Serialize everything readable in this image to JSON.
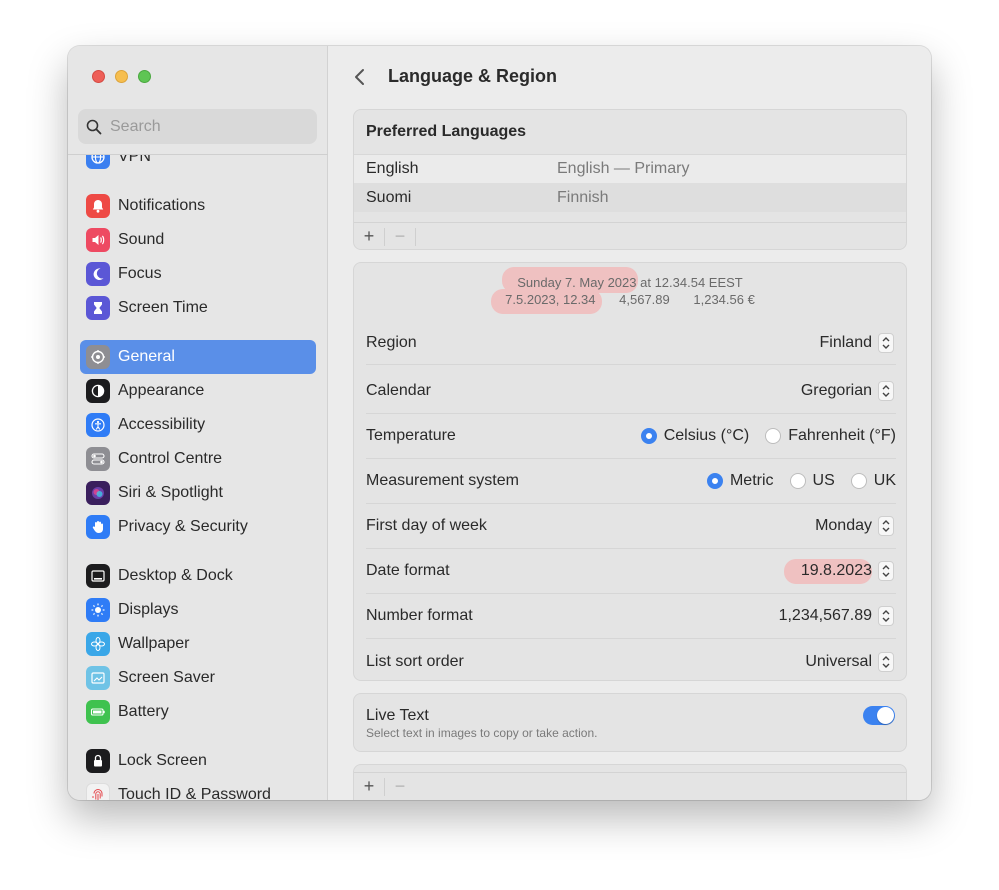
{
  "colors": {
    "accent": "#3b82f0",
    "selection": "#5a8fe8",
    "highlight": "#efc1c1"
  },
  "sidebar": {
    "search_placeholder": "Search",
    "items": [
      {
        "label": "VPN",
        "icon": "globe-icon",
        "color": "#3b7ff0"
      },
      {
        "label": "Notifications",
        "icon": "bell-icon",
        "color": "#ee4a45"
      },
      {
        "label": "Sound",
        "icon": "speaker-icon",
        "color": "#ee4a62"
      },
      {
        "label": "Focus",
        "icon": "moon-icon",
        "color": "#5b57d6"
      },
      {
        "label": "Screen Time",
        "icon": "hourglass-icon",
        "color": "#5b57d6"
      },
      {
        "label": "General",
        "icon": "gear-icon",
        "color": "#8e8e93",
        "selected": true
      },
      {
        "label": "Appearance",
        "icon": "appearance-icon",
        "color": "#1c1c1e"
      },
      {
        "label": "Accessibility",
        "icon": "accessibility-icon",
        "color": "#2f7cf6"
      },
      {
        "label": "Control Centre",
        "icon": "toggles-icon",
        "color": "#8e8e93"
      },
      {
        "label": "Siri & Spotlight",
        "icon": "siri-icon",
        "color": "#3a1f5d"
      },
      {
        "label": "Privacy & Security",
        "icon": "hand-icon",
        "color": "#2f7cf6"
      },
      {
        "label": "Desktop & Dock",
        "icon": "dock-icon",
        "color": "#1c1c1e"
      },
      {
        "label": "Displays",
        "icon": "sun-icon",
        "color": "#2f7cf6"
      },
      {
        "label": "Wallpaper",
        "icon": "flower-icon",
        "color": "#3aa7e8"
      },
      {
        "label": "Screen Saver",
        "icon": "screensaver-icon",
        "color": "#6fc3e6"
      },
      {
        "label": "Battery",
        "icon": "battery-icon",
        "color": "#3fc24f"
      },
      {
        "label": "Lock Screen",
        "icon": "lock-icon",
        "color": "#1c1c1e"
      },
      {
        "label": "Touch ID & Password",
        "icon": "fingerprint-icon",
        "color": "#f2f2f2"
      }
    ]
  },
  "header": {
    "title": "Language & Region"
  },
  "preferred_languages": {
    "title": "Preferred Languages",
    "rows": [
      {
        "name": "English",
        "desc": "English — Primary"
      },
      {
        "name": "Suomi",
        "desc": "Finnish"
      }
    ],
    "add_label": "+",
    "remove_label": "−"
  },
  "preview": {
    "line1_highlight": "Sunday 7. May 2023",
    "line1_rest": " at 12.34.54 EEST",
    "date_time": "7.5.2023, 12.34",
    "number": "4,567.89",
    "currency": "1,234.56 €"
  },
  "settings": {
    "region": {
      "label": "Region",
      "value": "Finland"
    },
    "calendar": {
      "label": "Calendar",
      "value": "Gregorian"
    },
    "temperature": {
      "label": "Temperature",
      "options": [
        "Celsius (°C)",
        "Fahrenheit (°F)"
      ],
      "selected": "Celsius (°C)"
    },
    "measurement": {
      "label": "Measurement system",
      "options": [
        "Metric",
        "US",
        "UK"
      ],
      "selected": "Metric"
    },
    "first_day": {
      "label": "First day of week",
      "value": "Monday"
    },
    "date_format": {
      "label": "Date format",
      "value": "19.8.2023"
    },
    "number_format": {
      "label": "Number format",
      "value": "1,234,567.89"
    },
    "list_sort": {
      "label": "List sort order",
      "value": "Universal"
    }
  },
  "live_text": {
    "title": "Live Text",
    "subtitle": "Select text in images to copy or take action.",
    "enabled": true
  },
  "apps_list": {
    "add_label": "+",
    "remove_label": "−"
  }
}
